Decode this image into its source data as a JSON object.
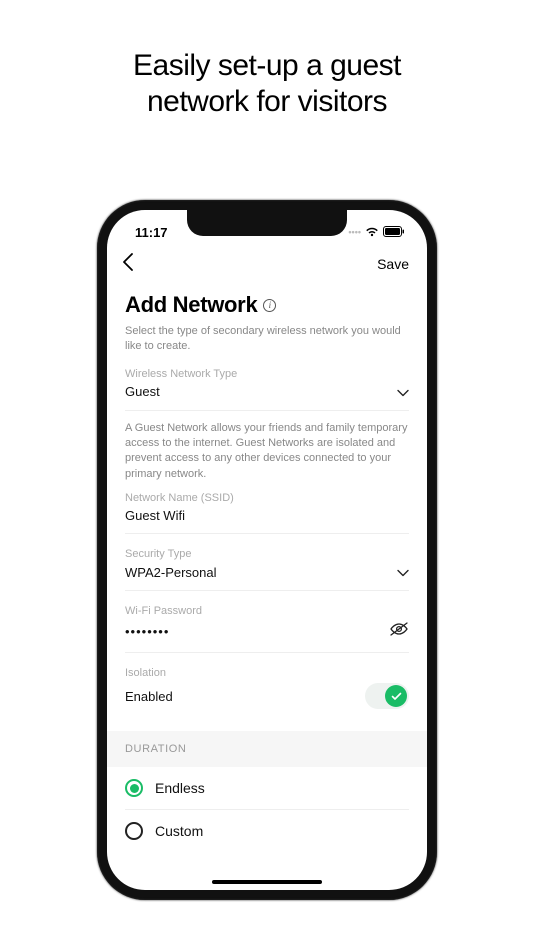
{
  "promo": {
    "line1": "Easily set-up a guest",
    "line2": "network for visitors"
  },
  "status": {
    "time": "11:17"
  },
  "nav": {
    "save_label": "Save"
  },
  "page": {
    "title": "Add Network",
    "subtitle": "Select the type of secondary wireless network you would like to create."
  },
  "fields": {
    "network_type": {
      "label": "Wireless Network Type",
      "value": "Guest",
      "help": "A Guest Network allows your friends and family temporary access to the internet. Guest Networks are isolated and prevent access to any other devices connected to your primary network."
    },
    "ssid": {
      "label": "Network Name (SSID)",
      "value": "Guest Wifi"
    },
    "security": {
      "label": "Security Type",
      "value": "WPA2-Personal"
    },
    "password": {
      "label": "Wi-Fi Password",
      "masked": "••••••••"
    },
    "isolation": {
      "label": "Isolation",
      "value": "Enabled",
      "on": true
    }
  },
  "duration": {
    "header": "DURATION",
    "options": [
      {
        "label": "Endless",
        "selected": true
      },
      {
        "label": "Custom",
        "selected": false
      }
    ]
  },
  "colors": {
    "accent": "#1abc66"
  }
}
